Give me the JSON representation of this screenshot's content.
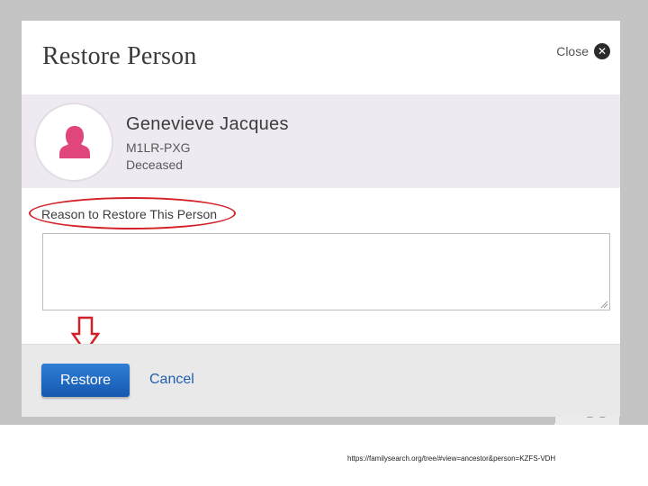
{
  "dialog": {
    "title": "Restore Person",
    "close_label": "Close"
  },
  "person": {
    "name": "Genevieve Jacques",
    "id": "M1LR-PXG",
    "status": "Deceased",
    "avatar_icon": "female-person-icon"
  },
  "reason": {
    "label": "Reason to Restore This Person",
    "value": "",
    "placeholder": ""
  },
  "footer": {
    "restore_label": "Restore",
    "cancel_label": "Cancel"
  },
  "annotation": {
    "highlight_color": "#d42027"
  },
  "colors": {
    "accent_button": "#1f68c2",
    "person_band": "#efe9f1",
    "avatar": "#e0457b"
  },
  "caption": {
    "url": "https://familysearch.org/tree/#view=ancestor&person=KZFS-VDH"
  }
}
